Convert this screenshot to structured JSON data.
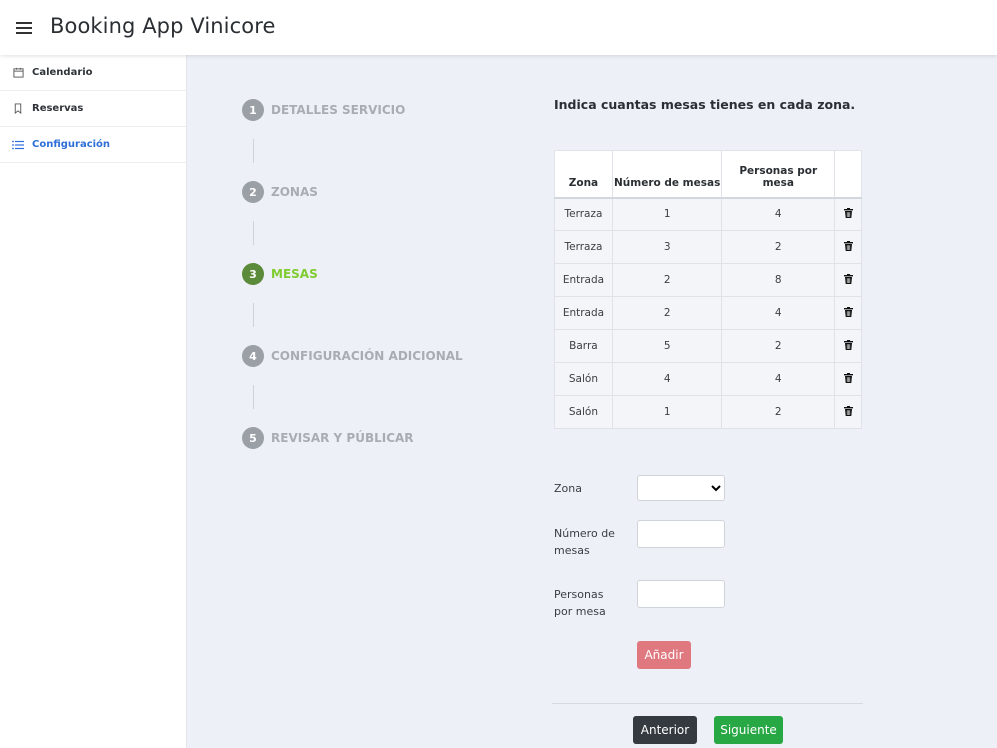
{
  "app": {
    "title": "Booking App Vinicore"
  },
  "sidebar": {
    "items": [
      {
        "label": "Calendario",
        "icon": "calendar-icon"
      },
      {
        "label": "Reservas",
        "icon": "bookmark-icon"
      },
      {
        "label": "Configuración",
        "icon": "list-icon",
        "active": true
      }
    ]
  },
  "steps": [
    {
      "num": "1",
      "label": "DETALLES SERVICIO"
    },
    {
      "num": "2",
      "label": "ZONAS"
    },
    {
      "num": "3",
      "label": "MESAS",
      "current": true
    },
    {
      "num": "4",
      "label": "CONFIGURACIÓN ADICIONAL"
    },
    {
      "num": "5",
      "label": "REVISAR Y PÚBLICAR"
    }
  ],
  "main": {
    "question": "Indica cuantas mesas tienes en cada zona.",
    "table": {
      "headers": [
        "Zona",
        "Número de mesas",
        "Personas por mesa"
      ],
      "rows": [
        [
          "Terraza",
          "1",
          "4"
        ],
        [
          "Terraza",
          "3",
          "2"
        ],
        [
          "Entrada",
          "2",
          "8"
        ],
        [
          "Entrada",
          "2",
          "4"
        ],
        [
          "Barra",
          "5",
          "2"
        ],
        [
          "Salón",
          "4",
          "4"
        ],
        [
          "Salón",
          "1",
          "2"
        ]
      ]
    },
    "form": {
      "zona_label": "Zona",
      "zona_value": "",
      "mesas_label": "Número de mesas",
      "mesas_value": "",
      "personas_label": "Personas por mesa",
      "personas_value": "",
      "add_label": "Añadir"
    },
    "nav": {
      "prev_label": "Anterior",
      "next_label": "Siguiente"
    }
  },
  "colors": {
    "accent": "#2f6fd8",
    "current_step": "#7fcc2f",
    "add_button": "#e07880",
    "next_button": "#28a745",
    "prev_button": "#343a40"
  }
}
